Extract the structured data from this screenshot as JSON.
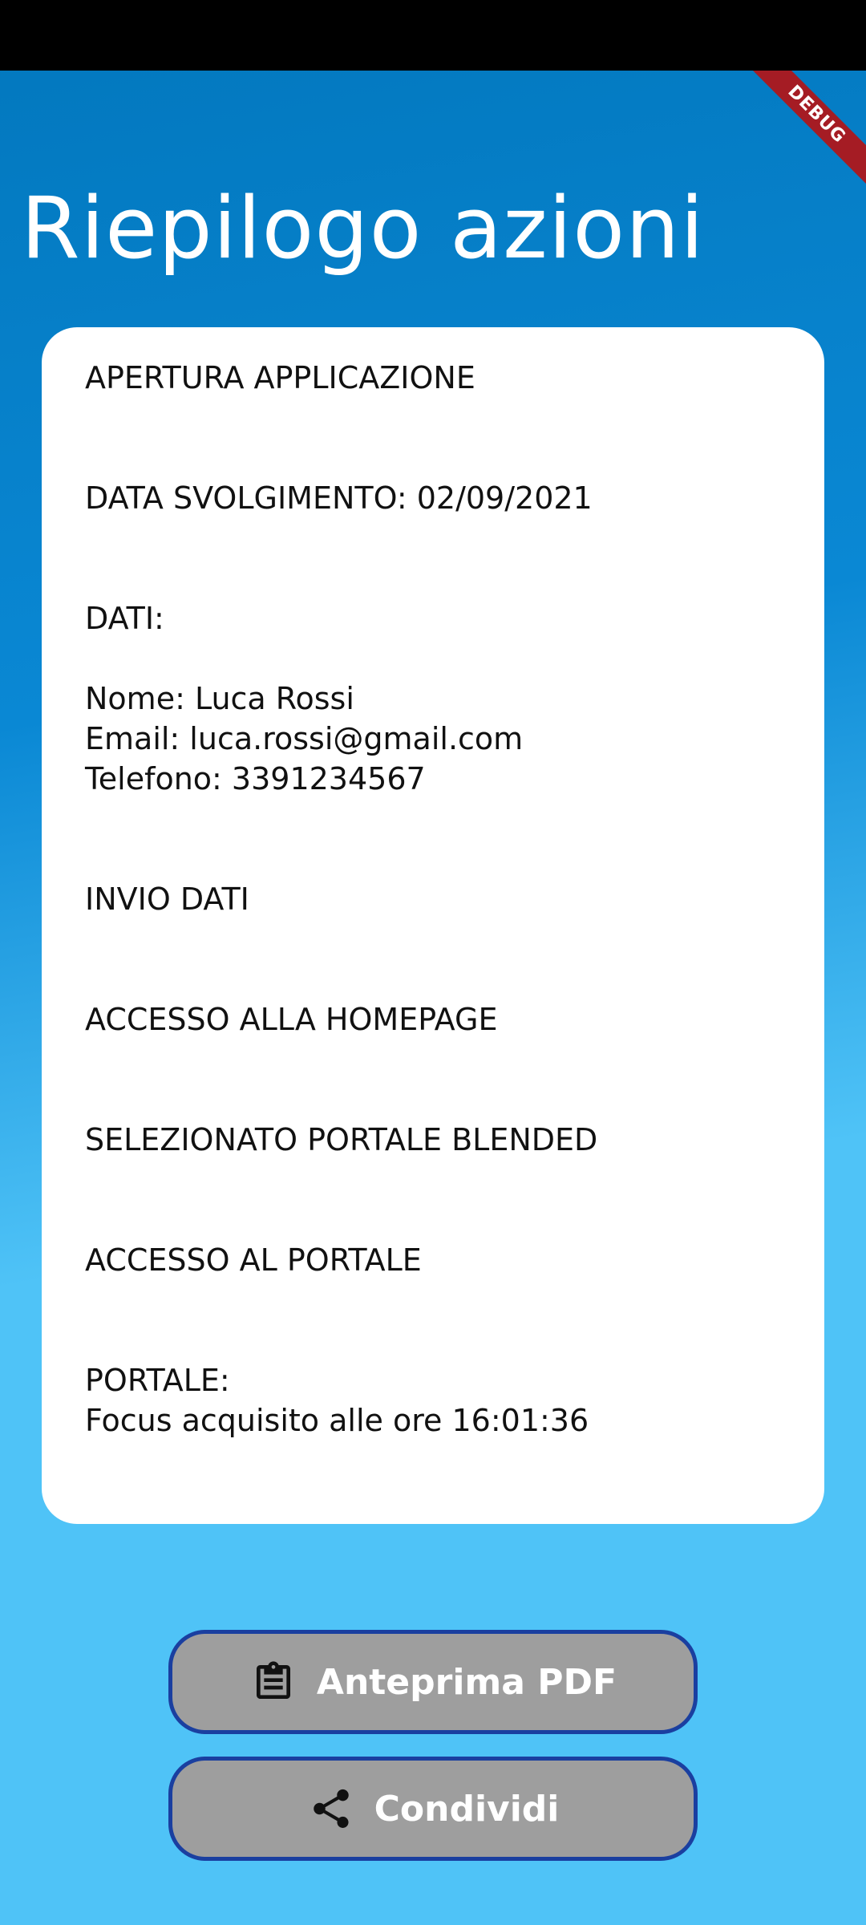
{
  "debug_banner": "DEBUG",
  "title": "Riepilogo azioni",
  "entries": [
    "APERTURA APPLICAZIONE",
    "DATA SVOLGIMENTO: 02/09/2021",
    "DATI:",
    "Nome: Luca Rossi\nEmail: luca.rossi@gmail.com\nTelefono: 3391234567",
    "INVIO DATI",
    "ACCESSO ALLA HOMEPAGE",
    "SELEZIONATO PORTALE BLENDED",
    "ACCESSO AL PORTALE",
    "PORTALE:\nFocus acquisito alle ore 16:01:36"
  ],
  "buttons": {
    "pdf": {
      "label": "Anteprima PDF",
      "icon": "clipboard-icon"
    },
    "share": {
      "label": "Condividi",
      "icon": "share-icon"
    }
  },
  "colors": {
    "gradient_top": "#0277bd",
    "gradient_bottom": "#4fc3f7",
    "button_bg": "#9e9e9e",
    "button_border": "#1a3fa0",
    "debug_ribbon": "#a51c24"
  }
}
